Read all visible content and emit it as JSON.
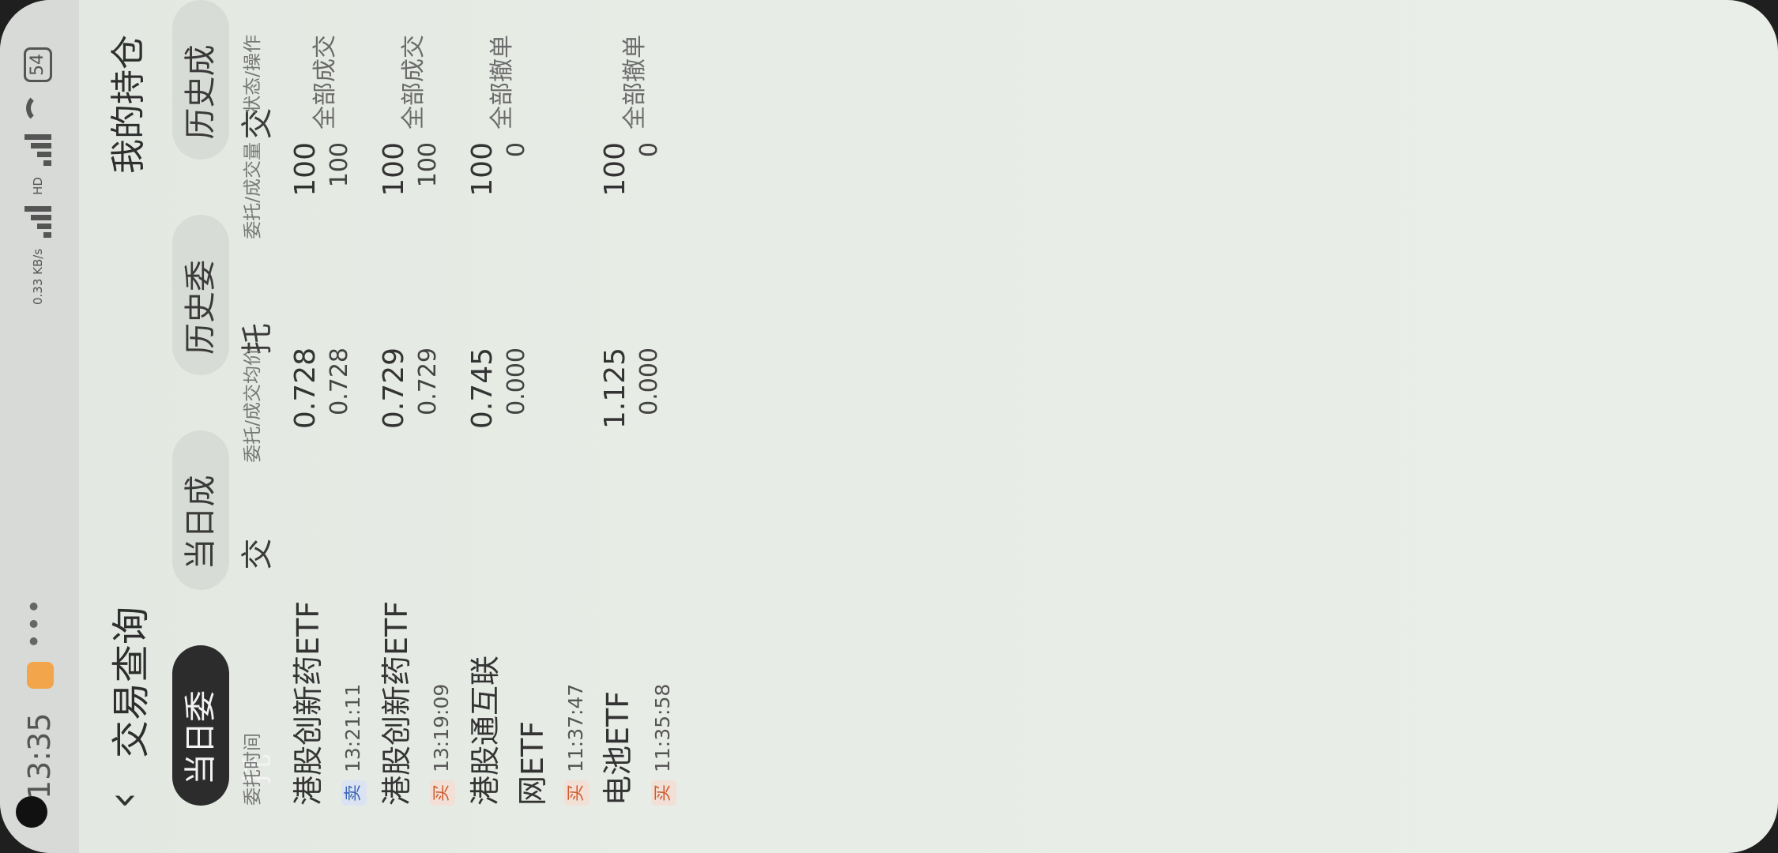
{
  "status_bar": {
    "time": "13:35",
    "dots": "•••",
    "net_speed": "0.33 KB/s",
    "network": "HD",
    "battery": "54"
  },
  "header": {
    "back_icon": "chevron-left-icon",
    "title": "交易查询",
    "holdings_link": "我的持仓"
  },
  "tabs": [
    {
      "label": "当日委托",
      "active": true
    },
    {
      "label": "当日成交",
      "active": false
    },
    {
      "label": "历史委托",
      "active": false
    },
    {
      "label": "历史成交",
      "active": false
    }
  ],
  "table": {
    "columns": [
      "委托时间",
      "委托/成交均价",
      "委托/成交量",
      "状态/操作"
    ],
    "rows": [
      {
        "name": "港股创新药ETF",
        "side": "卖",
        "side_type": "sell",
        "time": "13:21:11",
        "order_price": "0.728",
        "deal_price": "0.728",
        "order_qty": "100",
        "deal_qty": "100",
        "status": "全部成交"
      },
      {
        "name": "港股创新药ETF",
        "side": "买",
        "side_type": "buy",
        "time": "13:19:09",
        "order_price": "0.729",
        "deal_price": "0.729",
        "order_qty": "100",
        "deal_qty": "100",
        "status": "全部成交"
      },
      {
        "name": "港股通互联网ETF",
        "side": "买",
        "side_type": "buy",
        "time": "11:37:47",
        "order_price": "0.745",
        "deal_price": "0.000",
        "order_qty": "100",
        "deal_qty": "0",
        "status": "全部撤单"
      },
      {
        "name": "电池ETF",
        "side": "买",
        "side_type": "buy",
        "time": "11:35:58",
        "order_price": "1.125",
        "deal_price": "0.000",
        "order_qty": "100",
        "deal_qty": "0",
        "status": "全部撤单"
      }
    ]
  },
  "colors": {
    "active_tab_bg": "#2c2c2c",
    "sell_tag": "#3a66b5",
    "buy_tag": "#cf5a2d"
  }
}
